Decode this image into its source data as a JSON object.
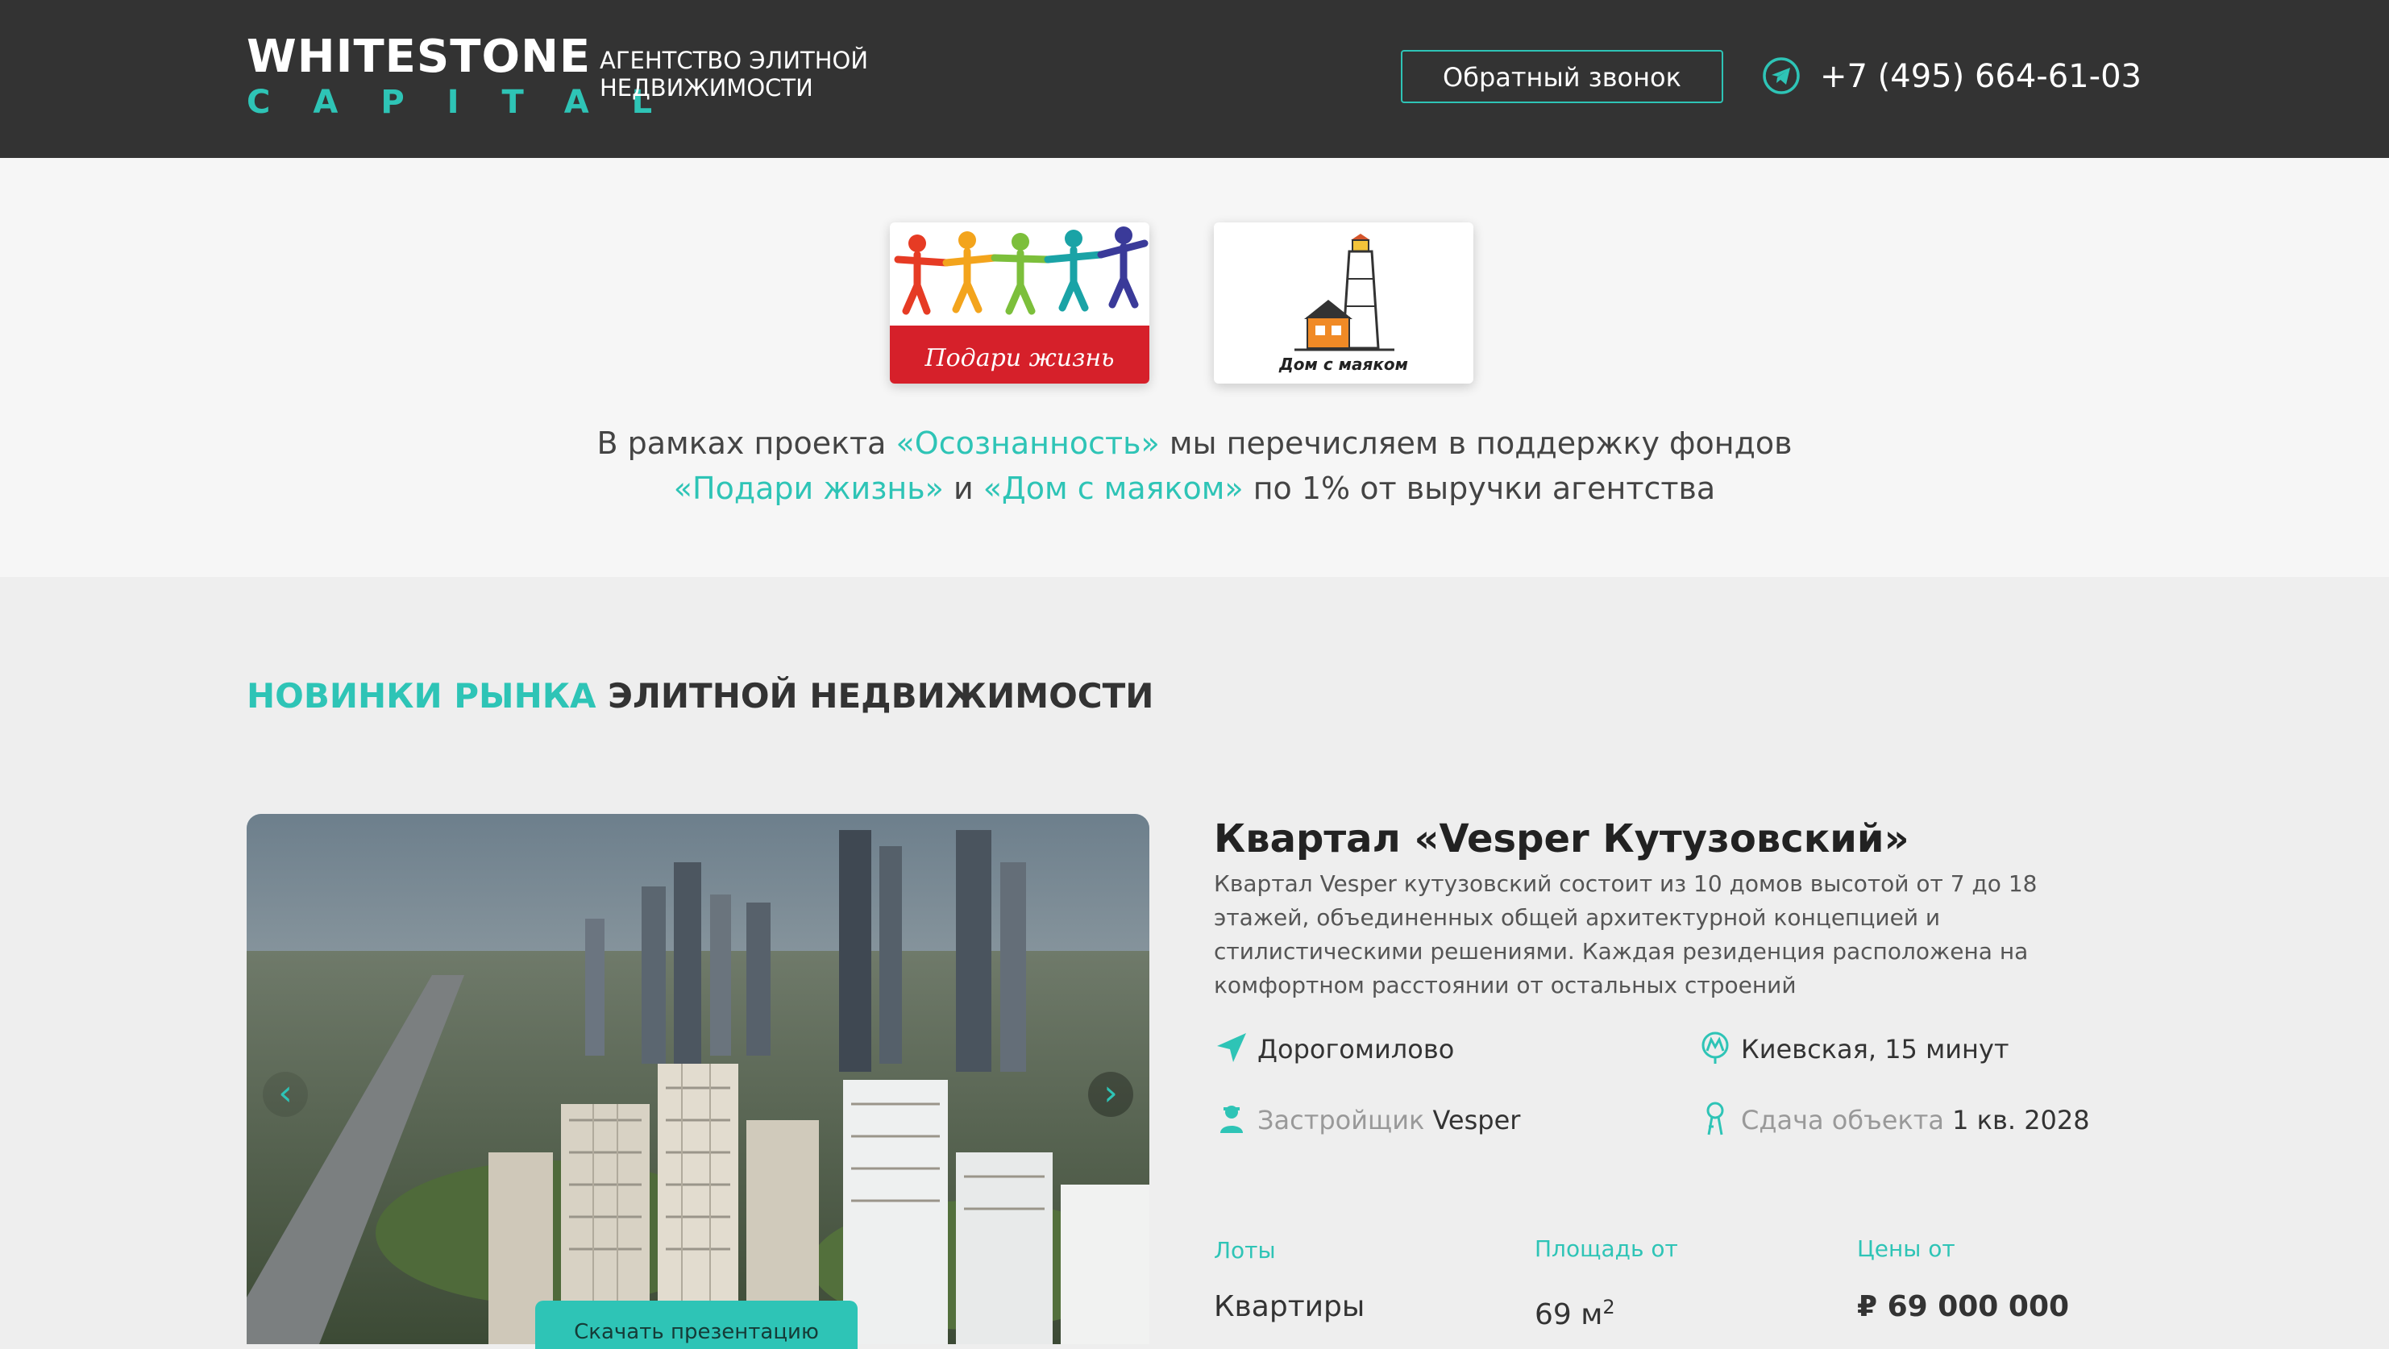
{
  "header": {
    "logo_main": "WHITESTONE",
    "logo_sub": "CAPITAL",
    "tagline": "АГЕНТСТВО ЭЛИТНОЙ НЕДВИЖИМОСТИ",
    "callback_label": "Обратный звонок",
    "phone": "+7 (495) 664-61-03",
    "contact_icon": "telegram-icon"
  },
  "charity": {
    "funds": [
      {
        "name": "Подари жизнь",
        "logo_text": "Подари жизнь"
      },
      {
        "name": "Дом с маяком",
        "logo_text": "Дом с маяком"
      }
    ],
    "text_before": "В рамках проекта ",
    "project_name": "«Осознанность»",
    "text_middle": " мы перечисляем в поддержку фондов",
    "fund_1": "«Подари жизнь»",
    "text_and": " и ",
    "fund_2": "«Дом с маяком»",
    "text_after": " по 1% от выручки агентства"
  },
  "news": {
    "title_accent": "НОВИНКИ РЫНКА",
    "title_rest": " ЭЛИТНОЙ НЕДВИЖИМОСТИ",
    "project": {
      "title": "Квартал «Vesper Кутузовский»",
      "description": "Квартал Vesper кутузовский состоит из 10 домов высотой от 7 до 18 этажей, объединенных общей архитектурной концепцией и стилистическими решениями. Каждая резиденция расположена на комфортном расстоянии от остальных строений",
      "district": "Дорогомилово",
      "metro": "Киевская, 15 минут",
      "developer_label": "Застройщик",
      "developer": "Vesper",
      "completion_label": "Сдача объекта",
      "completion": "1 кв. 2028",
      "lots_label": "Лоты",
      "area_label": "Площадь от",
      "price_label": "Цены от",
      "lots_value": "Квартиры",
      "area_value": "69 м",
      "area_unit_sup": "2",
      "price_value": "₽ 69 000 000",
      "download_label": "Скачать презентацию",
      "prev_arrow": "‹",
      "next_arrow": "›"
    }
  },
  "colors": {
    "accent": "#2ec4b6",
    "header_bg": "#333333",
    "podari_red": "#d6202a"
  }
}
